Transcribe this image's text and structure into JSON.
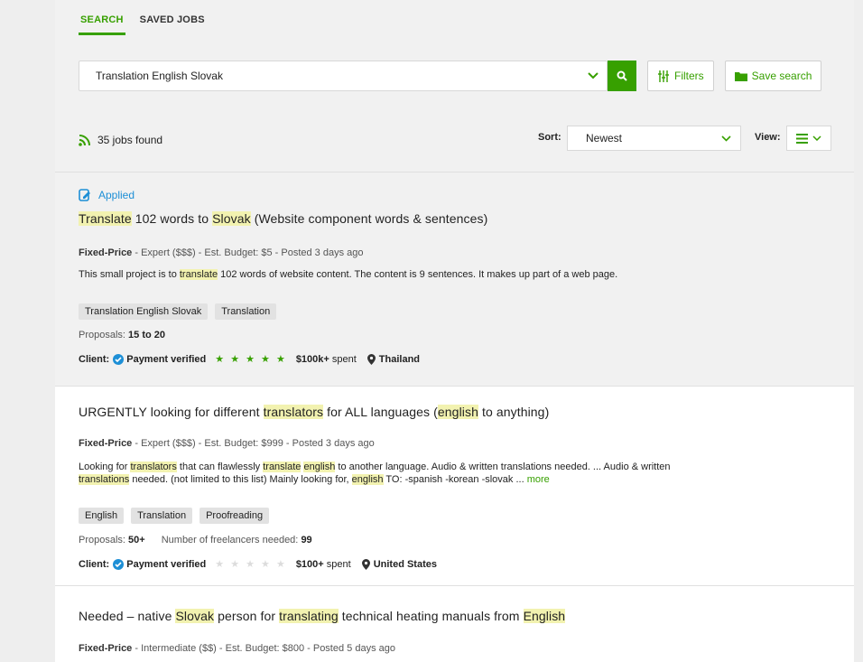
{
  "tabs": [
    {
      "label": "SEARCH",
      "active": true
    },
    {
      "label": "SAVED JOBS",
      "active": false
    }
  ],
  "search": {
    "value": "Translation English Slovak"
  },
  "filters_label": "Filters",
  "save_search_label": "Save search",
  "results_text": "35 jobs found",
  "sort": {
    "label": "Sort:",
    "value": "Newest"
  },
  "view": {
    "label": "View:"
  },
  "colors": {
    "accent": "#37a000",
    "applied": "#1d8fd6",
    "highlight": "#f2f2b0"
  },
  "jobs": [
    {
      "applied": "Applied",
      "title": [
        {
          "t": "Translate",
          "h": true
        },
        {
          "t": " 102 words to ",
          "h": false
        },
        {
          "t": "Slovak",
          "h": true
        },
        {
          "t": " (Website component words & sentences)",
          "h": false
        }
      ],
      "budget_type": "Fixed-Price",
      "meta": " - Expert ($$$) - Est. Budget: $5 - Posted 3 days ago",
      "description": [
        {
          "t": "This small project is to ",
          "h": false
        },
        {
          "t": "translate",
          "h": true
        },
        {
          "t": " 102 words of website content. The content is 9 sentences. It makes up part of a web page.",
          "h": false
        }
      ],
      "skills": [
        "Translation English Slovak",
        "Translation"
      ],
      "proposals_label": "Proposals:",
      "proposals": "15 to 20",
      "client_label": "Client:",
      "payment": "Payment verified",
      "rating": 5,
      "stars_text": "★ ★ ★ ★ ★",
      "spent": "$100k+",
      "spent_suffix": " spent",
      "location": "Thailand"
    },
    {
      "title": [
        {
          "t": "URGENTLY looking for different ",
          "h": false
        },
        {
          "t": "translators",
          "h": true
        },
        {
          "t": " for ALL languages (",
          "h": false
        },
        {
          "t": "english",
          "h": true
        },
        {
          "t": " to anything)",
          "h": false
        }
      ],
      "budget_type": "Fixed-Price",
      "meta": " - Expert ($$$) - Est. Budget: $999 - Posted 3 days ago",
      "description": [
        {
          "t": "Looking for ",
          "h": false
        },
        {
          "t": "translators",
          "h": true
        },
        {
          "t": " that can flawlessly ",
          "h": false
        },
        {
          "t": "translate",
          "h": true
        },
        {
          "t": " ",
          "h": false
        },
        {
          "t": "english",
          "h": true
        },
        {
          "t": " to another language. Audio & written translations needed. ... Audio & written ",
          "h": false
        },
        {
          "t": "translations",
          "h": true
        },
        {
          "t": " needed. (not limited to this list) Mainly looking for, ",
          "h": false
        },
        {
          "t": "english",
          "h": true
        },
        {
          "t": " TO: -spanish -korean -slovak ... ",
          "h": false
        }
      ],
      "more": "more",
      "skills": [
        "English",
        "Translation",
        "Proofreading"
      ],
      "proposals_label": "Proposals:",
      "proposals": "50+",
      "freelancers_label": "Number of freelancers needed:",
      "freelancers": "99",
      "client_label": "Client:",
      "payment": "Payment verified",
      "rating": 0,
      "stars_text": "★ ★ ★ ★ ★",
      "spent": "$100+",
      "spent_suffix": " spent",
      "location": "United States"
    },
    {
      "title": [
        {
          "t": "Needed – native ",
          "h": false
        },
        {
          "t": "Slovak",
          "h": true
        },
        {
          "t": " person for ",
          "h": false
        },
        {
          "t": "translating",
          "h": true
        },
        {
          "t": " technical heating manuals from ",
          "h": false
        },
        {
          "t": "English",
          "h": true
        }
      ],
      "budget_type": "Fixed-Price",
      "meta": " - Intermediate ($$) - Est. Budget: $800 - Posted 5 days ago"
    }
  ]
}
